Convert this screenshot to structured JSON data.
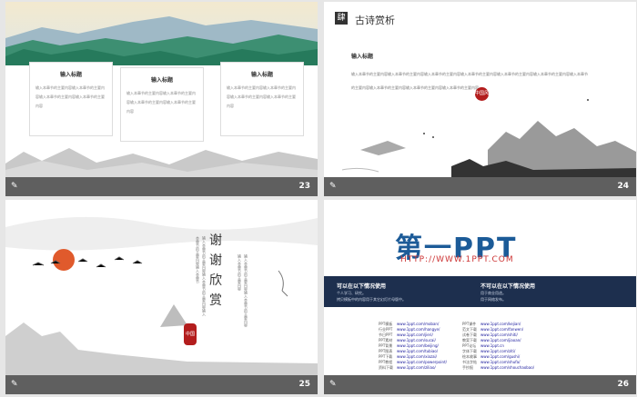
{
  "slides": [
    {
      "number": "23",
      "cards": [
        {
          "title": "输入标题",
          "text": "输入本章节的主要内容输入本章节的主要内容输入本章节的主要内容输入本章节的主要内容"
        },
        {
          "title": "输入标题",
          "text": "输入本章节的主要内容输入本章节的主要内容输入本章节的主要内容输入本章节的主要内容"
        },
        {
          "title": "输入标题",
          "text": "输入本章节的主要内容输入本章节的主要内容输入本章节的主要内容输入本章节的主要内容"
        }
      ]
    },
    {
      "number": "24",
      "icon_char": "肆",
      "title": "古诗赏析",
      "subtitle": "输入标题",
      "text": "输入本章节的主要内容输入本章节的主要内容输入本章节的主要内容输入本章节的主要内容输入本章节的主要内容输入本章节的主要内容输入本章节的主要内容输入本章节的主要内容输入本章节的主要内容输入本章节的主要内容",
      "seal": "中国风"
    },
    {
      "number": "25",
      "thanks": "谢谢欣赏",
      "poem_a": "输入本章节的主要内容输入本章节的主要内容输入本章节的主要内容输入本章节",
      "poem_b": "输入本章节的主要内容输入本章节的主要内容输入本章节的主要内容",
      "seal": "中国风"
    },
    {
      "number": "26",
      "logo": "第一PPT",
      "url": "HTTP://WWW.1PPT.COM",
      "left_heading": "可以在以下情况使用",
      "left_items": [
        "个人学习、研究。",
        "拷贝模板中的内容用于其它幻灯片母版中。"
      ],
      "right_heading": "不可以在以下情况使用",
      "right_items": [
        "用于商业用途。",
        "用于网络发布。"
      ],
      "links_left": [
        {
          "k": "PPT模板",
          "v": "www.1ppt.com/moban/"
        },
        {
          "k": "行业PPT",
          "v": "www.1ppt.com/hangye/"
        },
        {
          "k": "节日PPT",
          "v": "www.1ppt.com/jieri/"
        },
        {
          "k": "PPT素材",
          "v": "www.1ppt.com/sucai/"
        },
        {
          "k": "PPT背景",
          "v": "www.1ppt.com/beijing/"
        },
        {
          "k": "PPT图表",
          "v": "www.1ppt.com/tubiao/"
        },
        {
          "k": "PPT下载",
          "v": "www.1ppt.com/xiazai/"
        },
        {
          "k": "PPT教程",
          "v": "www.1ppt.com/powerpoint/"
        },
        {
          "k": "资料下载",
          "v": "www.1ppt.com/ziliao/"
        }
      ],
      "links_right": [
        {
          "k": "PPT课件",
          "v": "www.1ppt.com/kejian/"
        },
        {
          "k": "范文下载",
          "v": "www.1ppt.com/fanwen/"
        },
        {
          "k": "试卷下载",
          "v": "www.1ppt.com/shiti/"
        },
        {
          "k": "教案下载",
          "v": "www.1ppt.com/jiaoan/"
        },
        {
          "k": "PPT论坛",
          "v": "www.1ppt.cn"
        },
        {
          "k": "字体下载",
          "v": "www.1ppt.com/ziti/"
        },
        {
          "k": "绘本故事",
          "v": "www.1ppt.com/gushi/"
        },
        {
          "k": "书法字帖",
          "v": "www.1ppt.com/shufa/"
        },
        {
          "k": "手抄报",
          "v": "www.1ppt.com/shouchaobao/"
        }
      ]
    }
  ],
  "caption_icon": "✎"
}
